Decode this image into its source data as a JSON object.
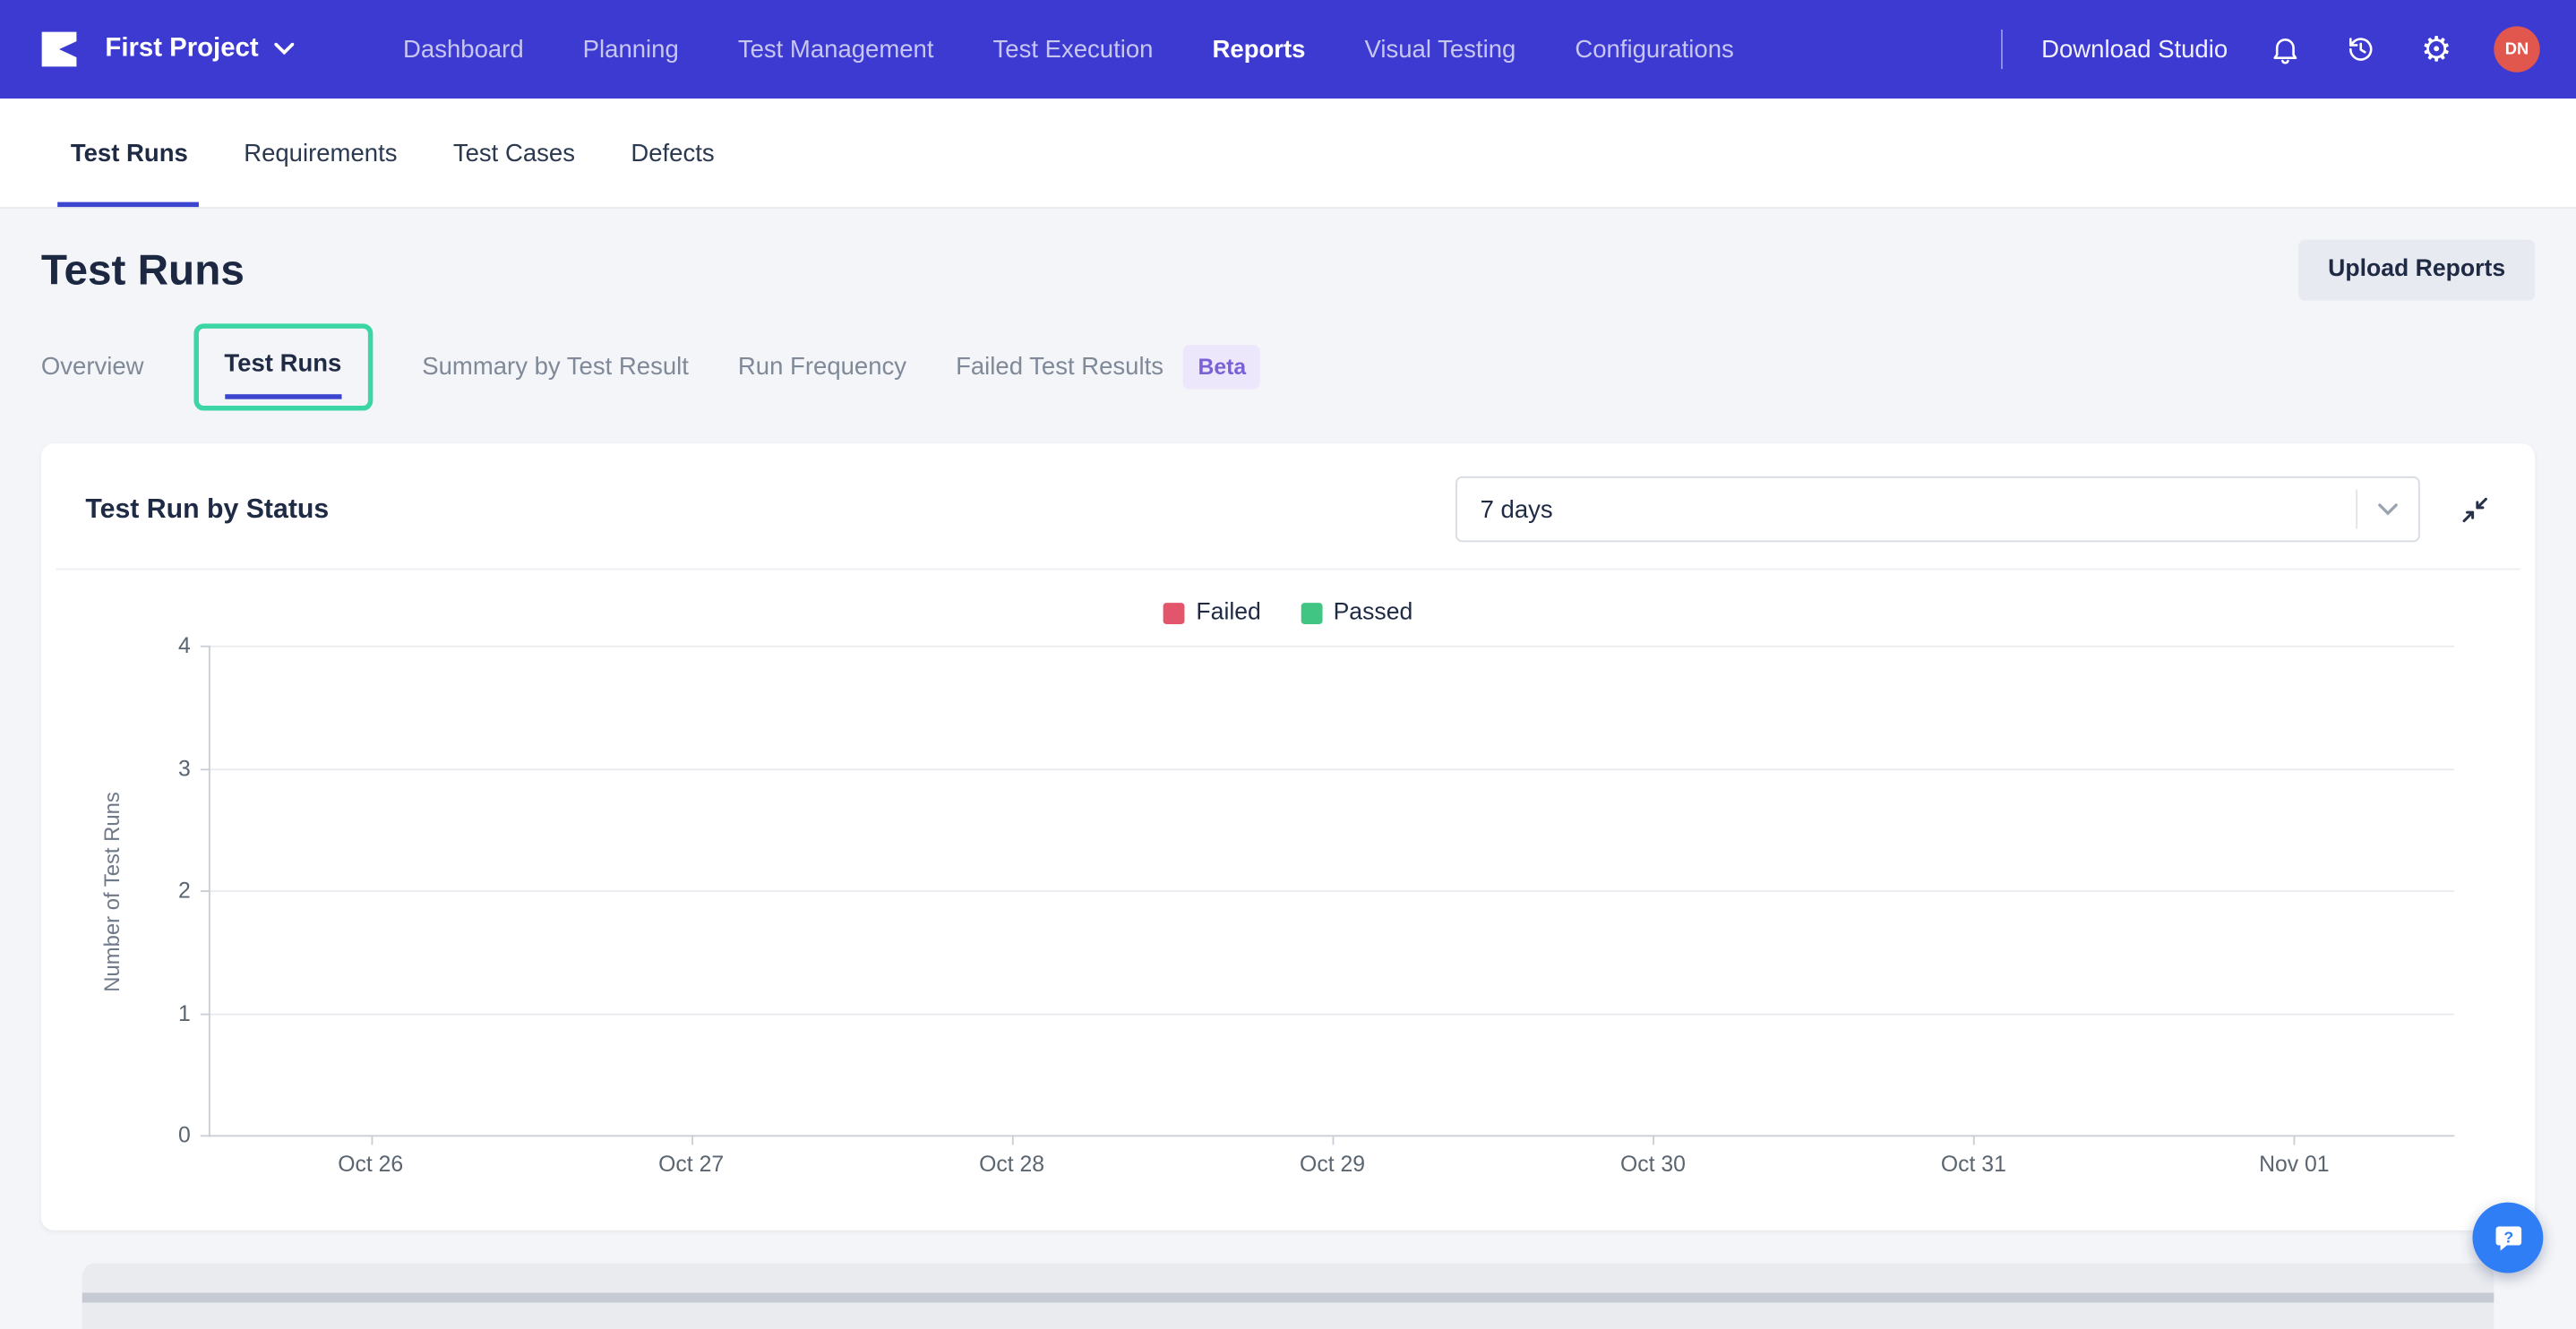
{
  "nav": {
    "project": "First Project",
    "items": [
      "Dashboard",
      "Planning",
      "Test Management",
      "Test Execution",
      "Reports",
      "Visual Testing",
      "Configurations"
    ],
    "active_item": "Reports",
    "download_studio": "Download Studio",
    "avatar_initials": "DN"
  },
  "tabs": {
    "items": [
      "Test Runs",
      "Requirements",
      "Test Cases",
      "Defects"
    ],
    "active": "Test Runs"
  },
  "page": {
    "title": "Test Runs",
    "upload_button": "Upload Reports"
  },
  "subtabs": {
    "items": [
      "Overview",
      "Test Runs",
      "Summary by Test Result",
      "Run Frequency",
      "Failed Test Results"
    ],
    "active": "Test Runs",
    "beta_badge": "Beta",
    "highlight_color": "#3cd6a4"
  },
  "widget": {
    "title": "Test Run by Status",
    "range_selected": "7 days"
  },
  "icons": {
    "logo": "katalon-logo",
    "project_caret": "chevron-down",
    "notifications": "bell",
    "history": "clock-restore",
    "settings": "gear",
    "range_caret": "chevron-down",
    "collapse": "collapse-arrows",
    "help": "chat-question"
  },
  "colors": {
    "nav_bg": "#3d3ad1",
    "accent_blue": "#3c45d0",
    "highlight_green": "#3cd6a4",
    "failed_red": "#e2556a",
    "passed_green": "#41c583"
  },
  "chart_data": {
    "type": "line",
    "title": "Test Run by Status",
    "categories": [
      "Oct 26",
      "Oct 27",
      "Oct 28",
      "Oct 29",
      "Oct 30",
      "Oct 31",
      "Nov 01"
    ],
    "series": [
      {
        "name": "Failed",
        "color": "#e2556a",
        "values": [
          null,
          null,
          null,
          null,
          null,
          null,
          null
        ]
      },
      {
        "name": "Passed",
        "color": "#41c583",
        "values": [
          null,
          null,
          null,
          null,
          null,
          null,
          null
        ]
      }
    ],
    "xlabel": "",
    "ylabel": "Number of Test Runs",
    "ylim": [
      0,
      4
    ],
    "yticks": [
      0,
      1,
      2,
      3,
      4
    ],
    "grid": true,
    "legend_position": "top"
  }
}
